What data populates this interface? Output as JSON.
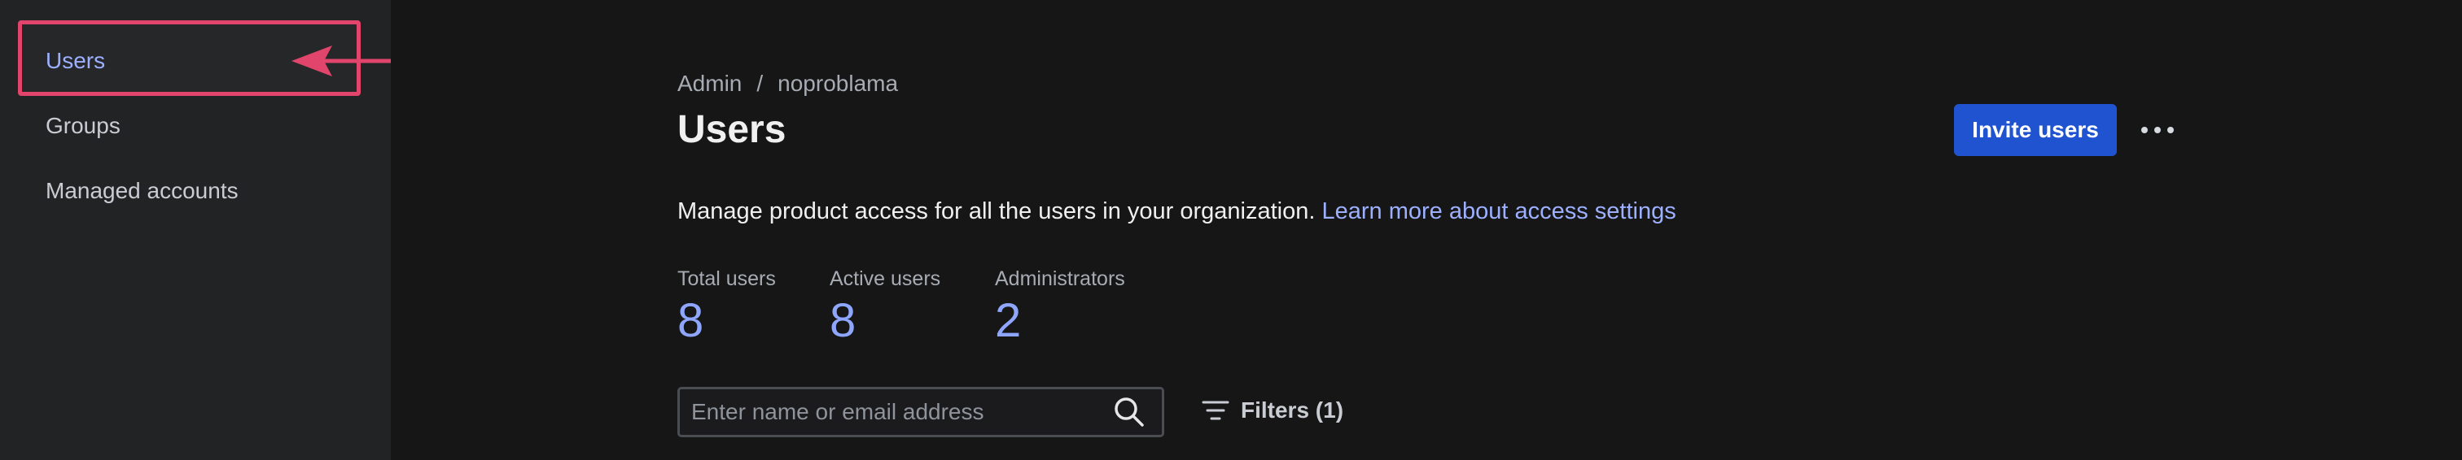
{
  "sidebar": {
    "items": [
      {
        "label": "Users",
        "active": true
      },
      {
        "label": "Groups",
        "active": false
      },
      {
        "label": "Managed accounts",
        "active": false
      }
    ]
  },
  "annotation": {
    "highlight_color": "#e2456b"
  },
  "breadcrumb": {
    "items": [
      "Admin",
      "noproblama"
    ],
    "separator": "/"
  },
  "header": {
    "title": "Users",
    "invite_button_label": "Invite users",
    "more_icon": "ellipsis-icon"
  },
  "description": {
    "text": "Manage product access for all the users in your organization. ",
    "link_text": "Learn more about access settings"
  },
  "stats": [
    {
      "label": "Total users",
      "value": "8"
    },
    {
      "label": "Active users",
      "value": "8"
    },
    {
      "label": "Administrators",
      "value": "2"
    }
  ],
  "search": {
    "placeholder": "Enter name or email address",
    "value": "",
    "icon": "search-icon"
  },
  "filters": {
    "label": "Filters (1)",
    "icon": "filter-icon"
  },
  "colors": {
    "accent": "#1f53d0",
    "link": "#9db0ff",
    "stat_value": "#8fa6ff",
    "sidebar_bg": "#222325",
    "main_bg": "#161616"
  }
}
